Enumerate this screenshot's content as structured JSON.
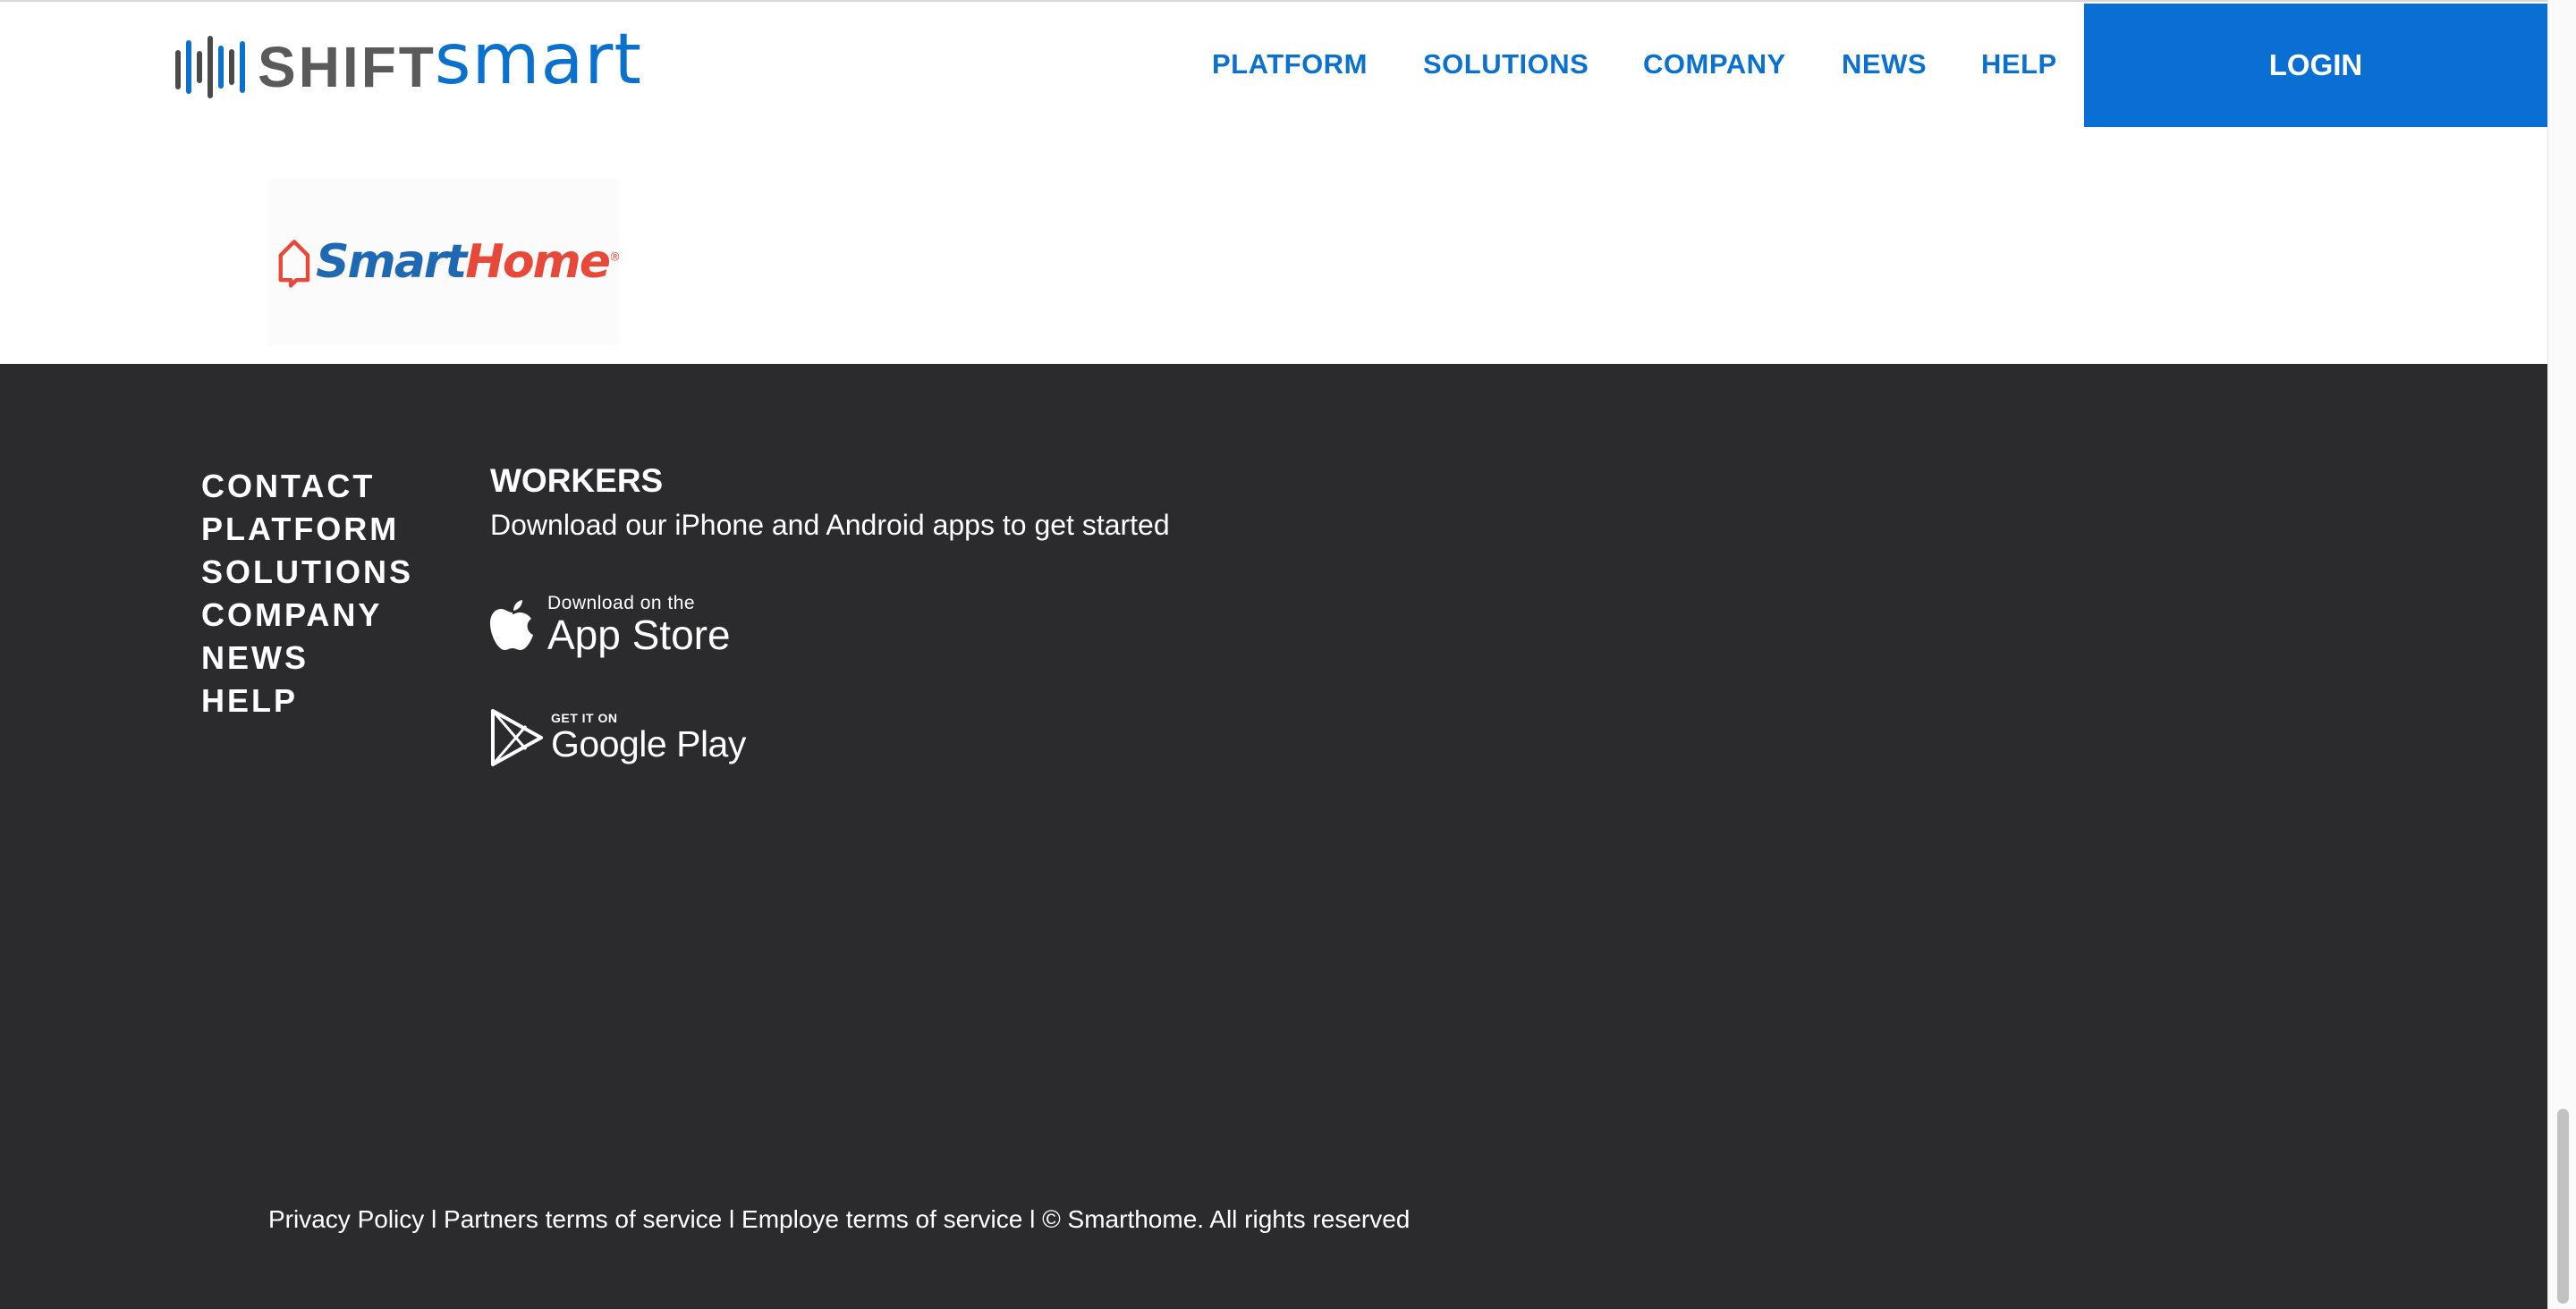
{
  "header": {
    "brand_shift": "SHIFT",
    "brand_smart": "smart",
    "nav": [
      {
        "label": "PLATFORM"
      },
      {
        "label": "SOLUTIONS"
      },
      {
        "label": "COMPANY"
      },
      {
        "label": "NEWS"
      },
      {
        "label": "HELP"
      }
    ],
    "login_label": "LOGIN"
  },
  "partner": {
    "name_smart": "Smart",
    "name_home": "Home",
    "reg_mark": "®"
  },
  "footer": {
    "links": [
      "CONTACT",
      "PLATFORM",
      "SOLUTIONS",
      "COMPANY",
      "NEWS",
      "HELP"
    ],
    "workers_title": "WORKERS",
    "workers_sub": "Download our iPhone and Android apps to get started",
    "appstore_small": "Download on the",
    "appstore_big": "App Store",
    "googleplay_small": "GET IT ON",
    "googleplay_big": "Google Play",
    "legal": {
      "privacy": "Privacy Policy",
      "sep": " l ",
      "partners_terms": "Partners terms of service",
      "employe_terms": "Employe terms of service",
      "copyright": "© Smarthome. All rights reserved"
    }
  },
  "colors": {
    "accent": "#0a71cf",
    "login_bg": "#0a6fd3",
    "footer_bg": "#2b2b2d",
    "smarthome_blue": "#1f69b2",
    "smarthome_red": "#e8483a"
  },
  "icons": [
    "shiftsmart-logo-bars",
    "smarthome-house-icon",
    "apple-icon",
    "google-play-icon"
  ]
}
